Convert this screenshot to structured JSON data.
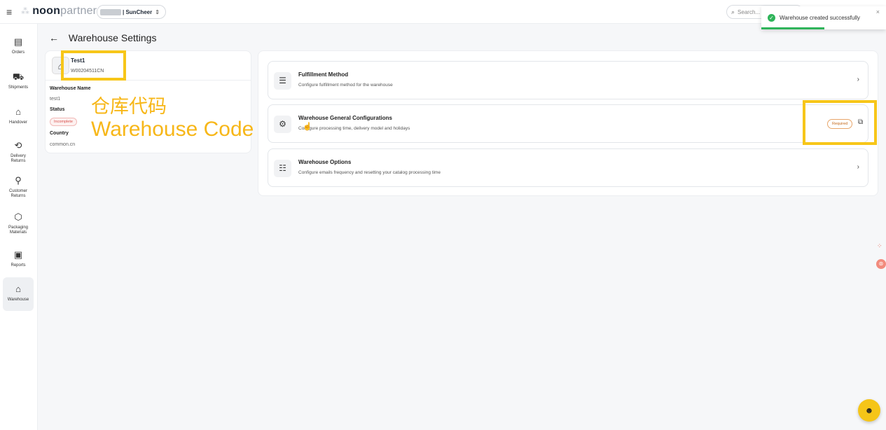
{
  "header": {
    "logo_mark": "⁂",
    "logo_bold": "noon",
    "logo_light": "partners",
    "store_label": "| SunCheer",
    "store_chevron": "⇕",
    "search_placeholder": "Search..."
  },
  "toast": {
    "message": "Warehouse created successfully",
    "close": "×"
  },
  "sidebar": {
    "items": [
      {
        "label": "Orders",
        "icon": "▤"
      },
      {
        "label": "Shipments",
        "icon": "⛟"
      },
      {
        "label": "Handover",
        "icon": "⌂"
      },
      {
        "label": "Delivery Returns",
        "icon": "⟲"
      },
      {
        "label": "Customer Returns",
        "icon": "⚲"
      },
      {
        "label": "Packaging Materials",
        "icon": "⬡"
      },
      {
        "label": "Reports",
        "icon": "▣"
      },
      {
        "label": "Warehouse",
        "icon": "⌂"
      }
    ]
  },
  "page": {
    "back": "←",
    "title": "Warehouse Settings"
  },
  "warehouse": {
    "name": "Test1",
    "code": "W00204511CN",
    "name_label": "Warehouse Name",
    "name_value": "test1",
    "status_label": "Status",
    "status_value": "Incomplete",
    "country_label": "Country",
    "country_value": "common.cn"
  },
  "annotation": {
    "cn": "仓库代码",
    "en": "Warehouse Code"
  },
  "options": [
    {
      "title": "Fulfillment Method",
      "desc": "Configure fulfillment method for the warehouse",
      "icon": "☰"
    },
    {
      "title": "Warehouse General Configurations",
      "desc": "Configure processing time, delivery model and holidays",
      "icon": "⚙",
      "badge": "Required"
    },
    {
      "title": "Warehouse Options",
      "desc": "Configure emails frequency and resetting your catalog processing time",
      "icon": "☷"
    }
  ],
  "colors": {
    "highlight": "#f7c619",
    "success": "#2fb45a",
    "incomplete": "#d9534f",
    "required": "#c46a1d",
    "chat_button": "#f5c518"
  }
}
